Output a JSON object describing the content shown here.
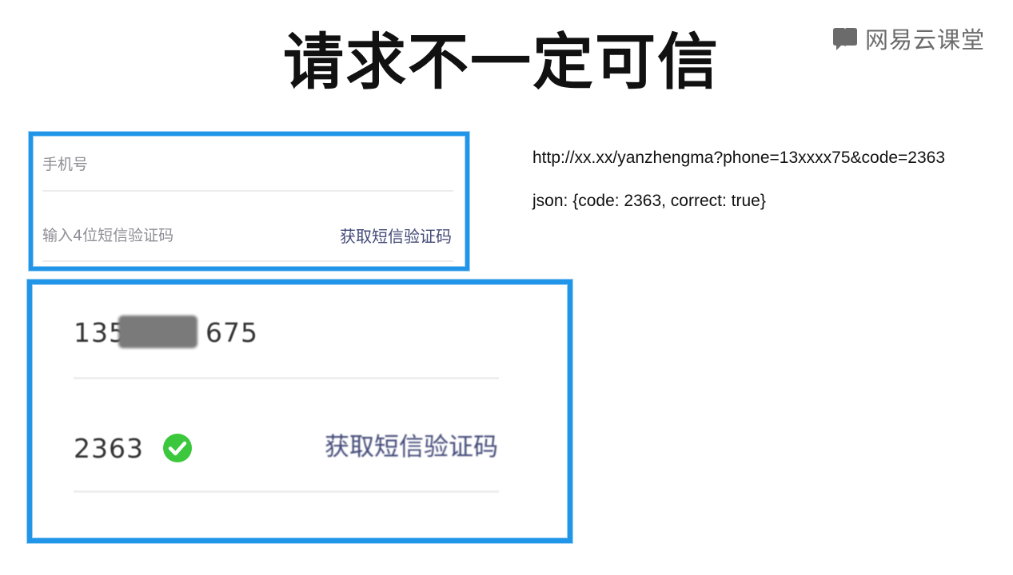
{
  "slide": {
    "title": "请求不一定可信"
  },
  "brand": {
    "name": "网易云课堂",
    "icon": "book-chat-icon",
    "color": "#6b6b6b"
  },
  "small_form": {
    "phone_placeholder": "手机号",
    "code_placeholder": "输入4位短信验证码",
    "get_code_label": "获取短信验证码"
  },
  "zoomed_form": {
    "phone_prefix": "135",
    "phone_suffix": "675",
    "code_value": "2363",
    "code_status_icon": "check-circle-icon",
    "get_code_label": "获取短信验证码"
  },
  "notes": {
    "request_url": "http://xx.xx/yanzhengma?phone=13xxxx75&code=2363",
    "response_json": "json: {code: 2363, correct: true}"
  },
  "colors": {
    "frame": "#2196e8",
    "check": "#3cc83c",
    "link": "#434a78"
  }
}
